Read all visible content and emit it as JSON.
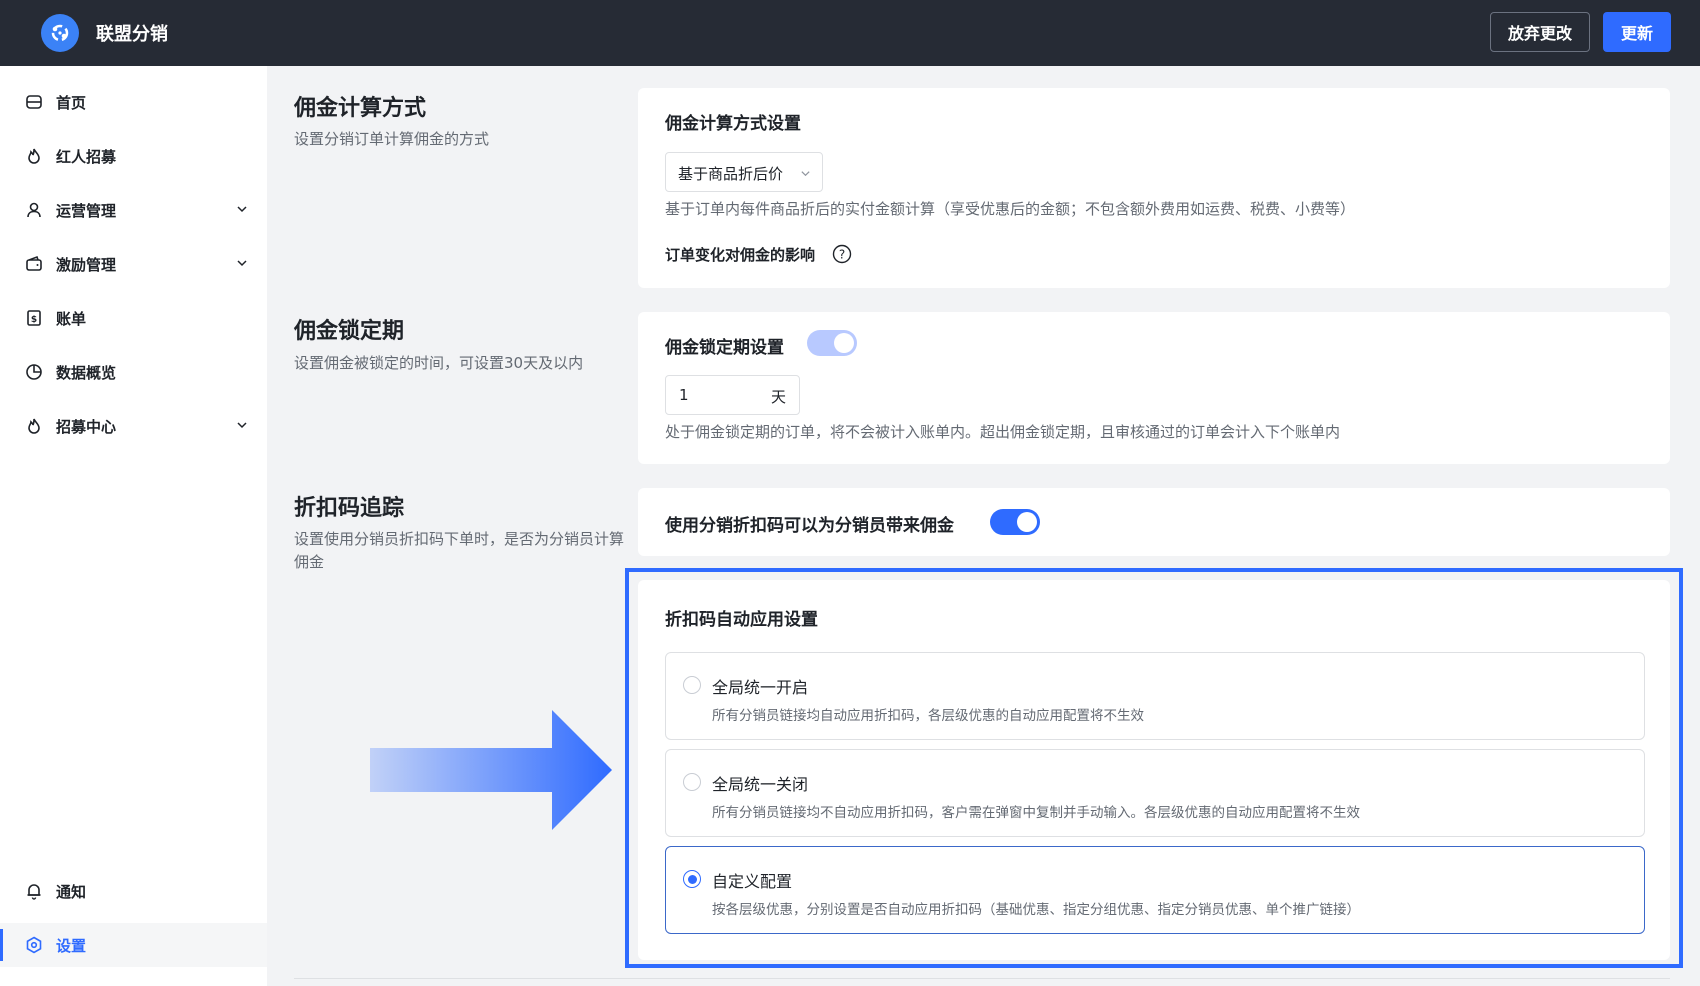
{
  "app": {
    "title": "联盟分销",
    "discard_label": "放弃更改",
    "update_label": "更新"
  },
  "sidebar": {
    "items": [
      {
        "label": "首页",
        "icon": "home-icon"
      },
      {
        "label": "红人招募",
        "icon": "flame-icon"
      },
      {
        "label": "运营管理",
        "icon": "user-icon"
      },
      {
        "label": "激励管理",
        "icon": "wallet-icon"
      },
      {
        "label": "账单",
        "icon": "bill-icon"
      },
      {
        "label": "数据概览",
        "icon": "pie-chart-icon"
      },
      {
        "label": "招募中心",
        "icon": "flame-icon"
      }
    ],
    "bottom_items": [
      {
        "label": "通知",
        "icon": "bell-icon"
      },
      {
        "label": "设置",
        "icon": "settings-icon",
        "active": true
      }
    ]
  },
  "sections": {
    "commission_calc": {
      "title": "佣金计算方式",
      "desc": "设置分销订单计算佣金的方式",
      "card_title": "佣金计算方式设置",
      "select_value": "基于商品折后价",
      "help": "基于订单内每件商品折后的实付金额计算（享受优惠后的金额；不包含额外费用如运费、税费、小费等）",
      "impact_label": "订单变化对佣金的影响"
    },
    "lock_period": {
      "title": "佣金锁定期",
      "desc": "设置佣金被锁定的时间，可设置30天及以内",
      "card_title": "佣金锁定期设置",
      "days_value": "1",
      "days_unit": "天",
      "help": "处于佣金锁定期的订单，将不会被计入账单内。超出佣金锁定期，且审核通过的订单会计入下个账单内"
    },
    "discount_tracking": {
      "title": "折扣码追踪",
      "desc": "设置使用分销员折扣码下单时，是否为分销员计算佣金",
      "toggle_label": "使用分销折扣码可以为分销员带来佣金",
      "auto_apply_title": "折扣码自动应用设置",
      "options": [
        {
          "label": "全局统一开启",
          "desc": "所有分销员链接均自动应用折扣码，各层级优惠的自动应用配置将不生效"
        },
        {
          "label": "全局统一关闭",
          "desc": "所有分销员链接均不自动应用折扣码，客户需在弹窗中复制并手动输入。各层级优惠的自动应用配置将不生效"
        },
        {
          "label": "自定义配置",
          "desc": "按各层级优惠，分别设置是否自动应用折扣码（基础优惠、指定分组优惠、指定分销员优惠、单个推广链接）"
        }
      ],
      "selected_option": 2
    }
  },
  "colors": {
    "accent": "#2f6bff",
    "topbar": "#262b35",
    "toggle_soft": "#b8c9ff"
  }
}
